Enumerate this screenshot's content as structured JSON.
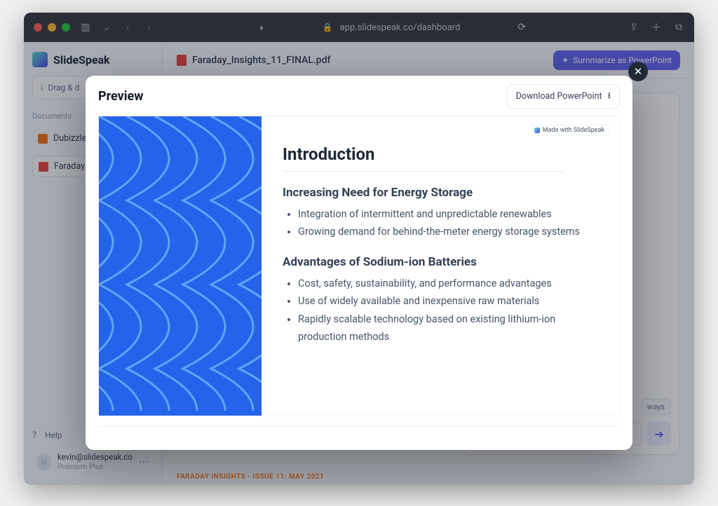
{
  "browser": {
    "url": "app.slidespeak.co/dashboard"
  },
  "app": {
    "brand": "SlideSpeak",
    "drag_label": "Drag & d",
    "docs_label": "Documents",
    "documents": [
      {
        "name": "Dubizzle"
      },
      {
        "name": "Faraday_"
      }
    ],
    "help_label": "Help",
    "user": {
      "email": "kevin@slidespeak.co",
      "plan": "Premium Plus"
    }
  },
  "main": {
    "file_name": "Faraday_Insights_11_FINAL.pdf",
    "summarize_label": "Summarize as PowerPoint",
    "footer_note": "FARADAY INSIGHTS - ISSUE 11: MAY 2021",
    "chip": "ways"
  },
  "modal": {
    "title": "Preview",
    "download_label": "Download PowerPoint",
    "made_with": "Made with SlideSpeak",
    "slide": {
      "heading": "Introduction",
      "sections": [
        {
          "title": "Increasing Need for Energy Storage",
          "bullets": [
            "Integration of intermittent and unpredictable renewables",
            "Growing demand for behind-the-meter energy storage systems"
          ]
        },
        {
          "title": "Advantages of Sodium-ion Batteries",
          "bullets": [
            "Cost, safety, sustainability, and performance advantages",
            "Use of widely available and inexpensive raw materials",
            "Rapidly scalable technology based on existing lithium-ion production methods"
          ]
        }
      ]
    }
  }
}
